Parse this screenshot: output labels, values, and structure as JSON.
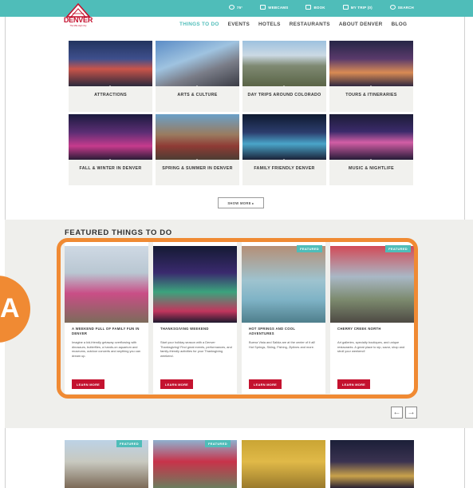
{
  "colors": {
    "brand_teal": "#4fbdb9",
    "brand_red": "#c4122f",
    "highlight_orange": "#f08a33",
    "band_gray": "#efefec"
  },
  "utility": {
    "items": [
      {
        "label": "75°",
        "icon": "sun-icon"
      },
      {
        "label": "WEBCAMS",
        "icon": "camera-icon"
      },
      {
        "label": "BOOK",
        "icon": "calendar-icon"
      },
      {
        "label": "MY TRIP (0)",
        "icon": "briefcase-icon"
      },
      {
        "label": "SEARCH",
        "icon": "search-icon"
      }
    ]
  },
  "brand": {
    "logo_text": "DENVER",
    "tagline": "The Mile High City"
  },
  "nav": {
    "items": [
      "THINGS TO DO",
      "EVENTS",
      "HOTELS",
      "RESTAURANTS",
      "ABOUT DENVER",
      "BLOG"
    ],
    "active": "THINGS TO DO"
  },
  "categories": [
    "ATTRACTIONS",
    "ARTS & CULTURE",
    "DAY TRIPS AROUND COLORADO",
    "TOURS & ITINERARIES",
    "FALL & WINTER IN DENVER",
    "SPRING & SUMMER IN DENVER",
    "FAMILY FRIENDLY DENVER",
    "MUSIC & NIGHTLIFE"
  ],
  "show_more": "SHOW MORE ▸",
  "featured": {
    "title": "FEATURED THINGS TO DO",
    "tag_label": "FEATURED",
    "button_label": "LEARN MORE",
    "cards": [
      {
        "heading": "A WEEKEND FULL OF FAMILY FUN IN DENVER",
        "desc": "Imagine a kid-friendly getaway overflowing with dinosaurs, butterflies, a hands-on aquarium and museums, outdoor concerts and anything you can dream up."
      },
      {
        "heading": "THANKSGIVING WEEKEND",
        "desc": "Start your holiday season with a Denver Thanksgiving! Find great events, performances, and family-friendly activities for your Thanksgiving weekend."
      },
      {
        "heading": "HOT SPRINGS AND COOL ADVENTURES",
        "desc": "Buena Vista and Salida are at the center of it all! Hot Springs, Skiing, Fishing, Ziplines and more."
      },
      {
        "heading": "CHERRY CREEK NORTH",
        "desc": "Art galleries, specialty boutiques, and unique restaurants. A great place to sip, savor, shop and stroll your weekend!"
      }
    ]
  },
  "annotation": {
    "letter": "A"
  },
  "carousel": {
    "prev": "←",
    "next": "→"
  }
}
